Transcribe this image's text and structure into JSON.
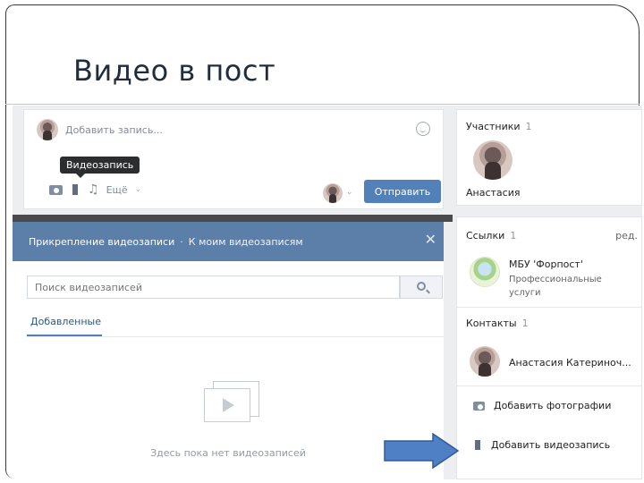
{
  "slide": {
    "title": "Видео в пост"
  },
  "composer": {
    "placeholder": "Добавить запись...",
    "tooltip": "Видеозапись",
    "more_label": "Ещё",
    "send_label": "Отправить"
  },
  "modal": {
    "title": "Прикрепление видеозаписи",
    "separator": "·",
    "link": "К моим видеозаписям",
    "search_placeholder": "Поиск видеозаписей",
    "tab_added": "Добавленные",
    "empty_text": "Здесь пока нет видеозаписей"
  },
  "sidebar": {
    "members": {
      "title": "Участники",
      "count": "1",
      "name": "Анастасия"
    },
    "links": {
      "title": "Ссылки",
      "count": "1",
      "edit": "ред.",
      "name": "МБУ 'Форпост'",
      "description": "Профессиональные услуги"
    },
    "contacts": {
      "title": "Контакты",
      "count": "1",
      "name": "Анастасия Катериноч..."
    },
    "actions": {
      "add_photos": "Добавить фотографии",
      "add_video": "Добавить видеозапись"
    }
  },
  "colors": {
    "accent": "#5181b8",
    "modal_header": "#5b7fa8",
    "arrow": "#4f7fc4"
  }
}
